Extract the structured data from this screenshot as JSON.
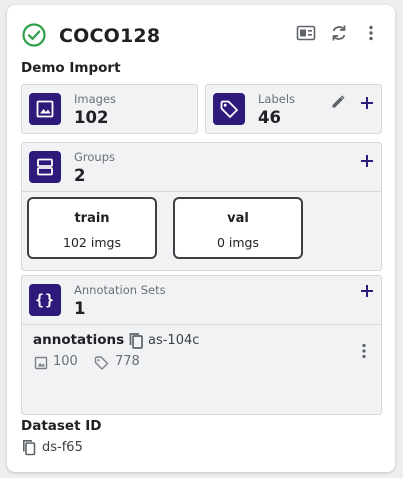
{
  "header": {
    "title": "COCO128",
    "subtitle": "Demo Import",
    "status_icon": "check-circle-icon",
    "actions": [
      "preview-icon",
      "sync-icon",
      "more-vert-icon"
    ]
  },
  "stats": {
    "images": {
      "label": "Images",
      "value": "102",
      "icon": "image-icon"
    },
    "labels": {
      "label": "Labels",
      "value": "46",
      "icon": "tag-icon"
    }
  },
  "groups": {
    "label": "Groups",
    "value": "2",
    "icon": "groups-icon",
    "items": [
      {
        "name": "train",
        "count": "102 imgs"
      },
      {
        "name": "val",
        "count": "0 imgs"
      }
    ]
  },
  "annotation_sets": {
    "label": "Annotation Sets",
    "value": "1",
    "icon": "braces-icon",
    "items": [
      {
        "name": "annotations",
        "id": "as-104c",
        "image_count": "100",
        "label_count": "778"
      }
    ]
  },
  "dataset": {
    "label": "Dataset ID",
    "id": "ds-f65"
  },
  "colors": {
    "accent": "#2e1a7a",
    "success": "#2e9e48",
    "panel_bg": "#f1f2f4"
  }
}
